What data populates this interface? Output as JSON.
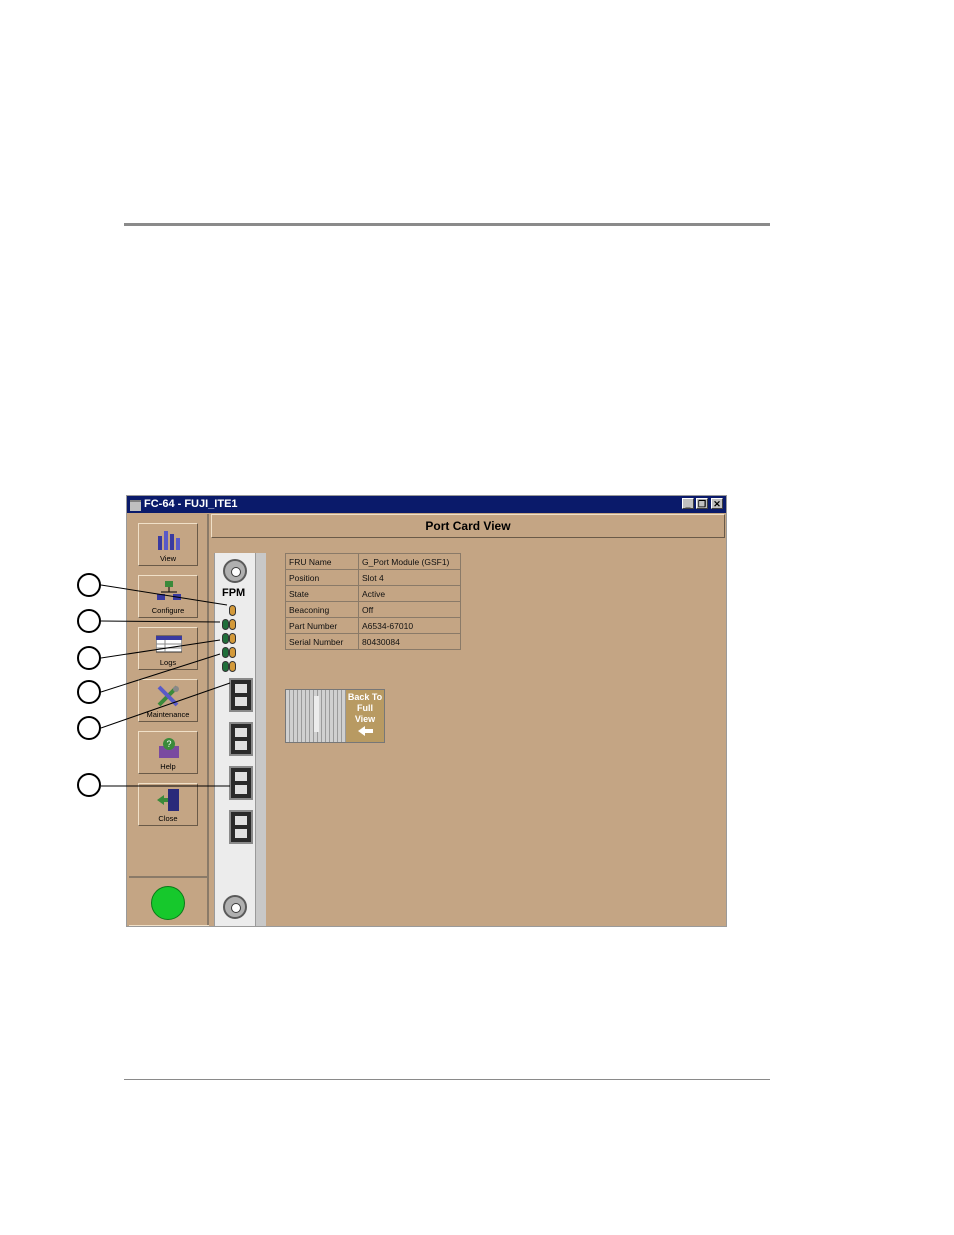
{
  "window": {
    "title": "FC-64  - FUJI_ITE1",
    "minimize_label": "_",
    "restore_label": "❐",
    "close_label": "✕"
  },
  "sidebar": {
    "items": [
      {
        "label": "View",
        "icon": "view-icon"
      },
      {
        "label": "Configure",
        "icon": "configure-icon"
      },
      {
        "label": "Logs",
        "icon": "logs-icon"
      },
      {
        "label": "Maintenance",
        "icon": "maintenance-icon"
      },
      {
        "label": "Help",
        "icon": "help-icon"
      },
      {
        "label": "Close",
        "icon": "close-icon"
      }
    ],
    "status_color": "#16c82c"
  },
  "header": {
    "title": "Port Card View"
  },
  "card": {
    "label": "FPM"
  },
  "fru_info": [
    {
      "key": "FRU Name",
      "value": "G_Port Module (GSF1)"
    },
    {
      "key": "Position",
      "value": "Slot 4"
    },
    {
      "key": "State",
      "value": "Active"
    },
    {
      "key": "Beaconing",
      "value": "Off"
    },
    {
      "key": "Part Number",
      "value": "A6534-67010"
    },
    {
      "key": "Serial Number",
      "value": "80430084"
    }
  ],
  "back_to_full_view": {
    "line1": "Back To",
    "line2": "Full",
    "line3": "View"
  },
  "colors": {
    "window_bg": "#c4a584",
    "titlebar": "#0a1a6a",
    "status_led": "#16c82c"
  }
}
